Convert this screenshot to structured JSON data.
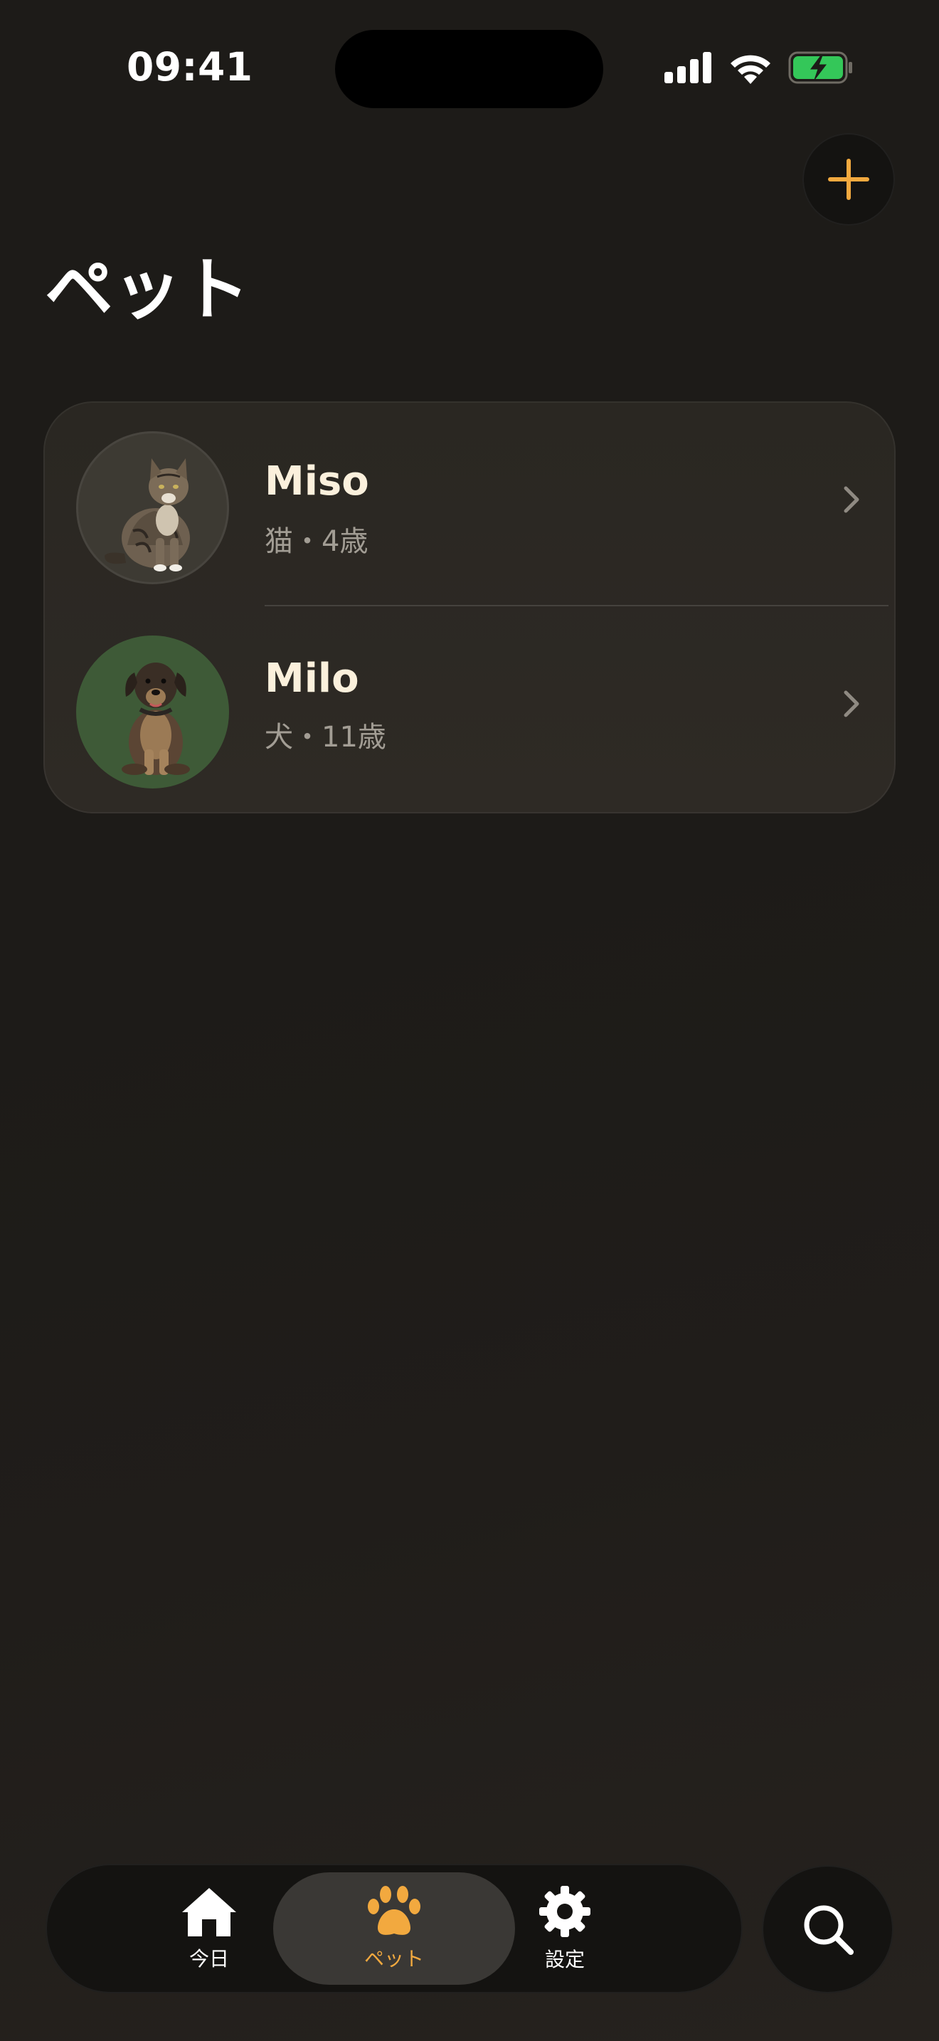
{
  "status_bar": {
    "time": "09:41"
  },
  "header": {
    "title": "ペット",
    "add_icon": "plus-icon"
  },
  "pets": [
    {
      "name": "Miso",
      "meta": "猫・4歳",
      "avatar_icon": "cat-photo"
    },
    {
      "name": "Milo",
      "meta": "犬・11歳",
      "avatar_icon": "dog-photo"
    }
  ],
  "tab_bar": {
    "tabs": [
      {
        "label": "今日",
        "icon": "house-icon",
        "selected": false
      },
      {
        "label": "ペット",
        "icon": "paw-icon",
        "selected": true
      },
      {
        "label": "設定",
        "icon": "gear-icon",
        "selected": false
      }
    ],
    "search_icon": "search-icon"
  },
  "colors": {
    "accent": "#f2a93f",
    "background": "#1d1b18",
    "card": "#2b2823",
    "battery": "#34c759"
  }
}
